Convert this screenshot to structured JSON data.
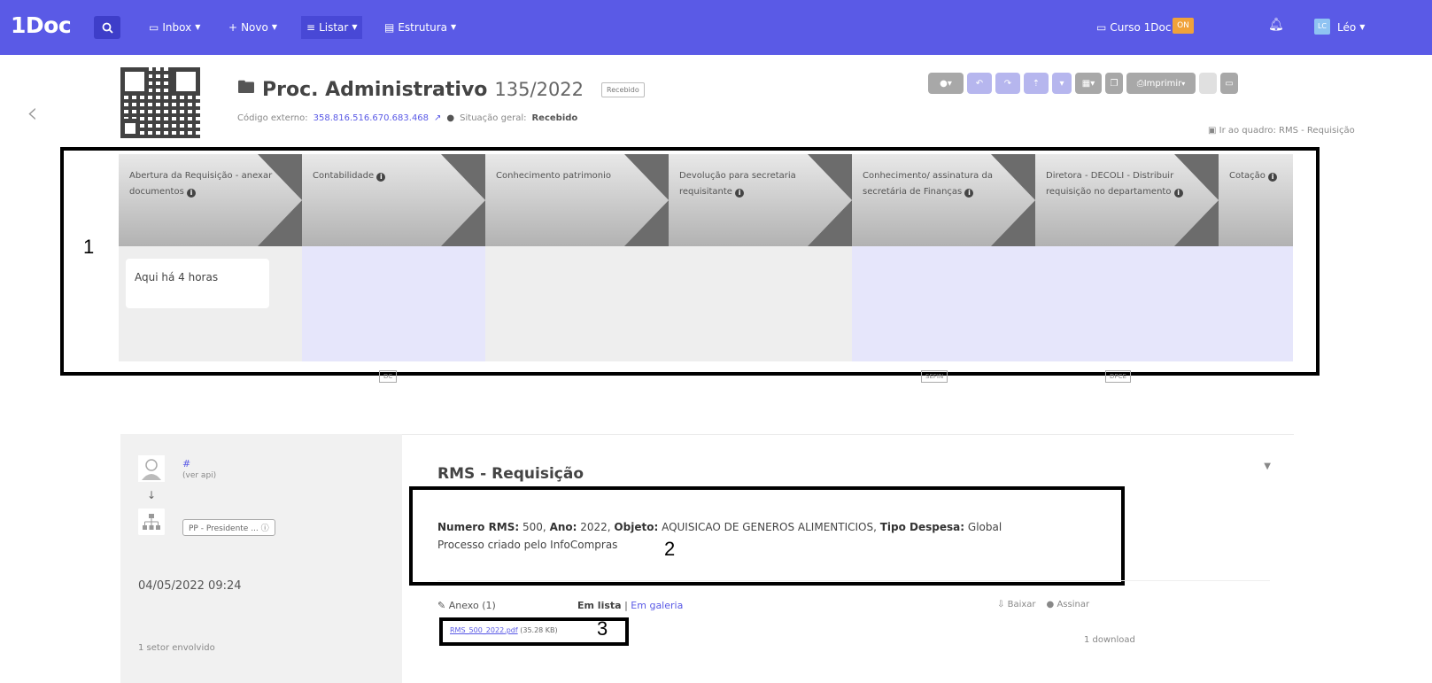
{
  "topbar": {
    "logo": "1Doc",
    "search_icon": "search-icon",
    "nav": [
      {
        "label": "Inbox",
        "icon": "inbox-icon"
      },
      {
        "label": "Novo",
        "icon": "plus-icon"
      },
      {
        "label": "Listar",
        "icon": "list-icon"
      },
      {
        "label": "Estrutura",
        "icon": "structure-icon"
      }
    ],
    "org_label": "Curso 1Doc",
    "org_badge": "ON",
    "user_label": "Léo",
    "color": "#5a5ae6"
  },
  "header": {
    "type": "Proc. Administrativo",
    "number": "135/2022",
    "status_pill": "Recebido",
    "external_code_label": "Código externo:",
    "external_code": "358.816.516.670.683.468",
    "situacao_label": "Situação geral:",
    "situacao_value": "Recebido",
    "print_label": "Imprimir",
    "goto_board": "Ir ao quadro: RMS - Requisição"
  },
  "workflow": {
    "annotation": "1",
    "stages": [
      {
        "label": "Abertura da Requisição - anexar documentos",
        "info": true,
        "card": "Aqui há 4 horas"
      },
      {
        "label": "Contabilidade",
        "info": true,
        "card": ""
      },
      {
        "label": "Conhecimento patrimonio",
        "info": false,
        "card": ""
      },
      {
        "label": "Devolução para secretaria requisitante",
        "info": true,
        "card": ""
      },
      {
        "label": "Conhecimento/ assinatura da secretária de Finanças",
        "info": true,
        "card": ""
      },
      {
        "label": "Diretora - DECOLI - Distribuir requisição no departamento",
        "info": true,
        "card": ""
      },
      {
        "label": "Cotação",
        "info": true,
        "card": ""
      }
    ],
    "tags": [
      "DC",
      "SEFIN",
      "DPCE"
    ]
  },
  "activity": {
    "hash": "#",
    "sub_note": "(ver api)",
    "org_pill": "PP - Presidente ...",
    "datetime": "04/05/2022 09:24",
    "sectors": "1 setor envolvido"
  },
  "document": {
    "title": "RMS - Requisição",
    "fields": [
      {
        "label": "Numero RMS:",
        "value": " 500, "
      },
      {
        "label": "Ano:",
        "value": " 2022, "
      },
      {
        "label": "Objeto:",
        "value": " AQUISICAO DE GENEROS ALIMENTICIOS, "
      },
      {
        "label": "Tipo Despesa:",
        "value": " Global"
      }
    ],
    "second_line": "Processo criado pelo InfoCompras",
    "annotation_2": "2",
    "attachments_label": "Anexo (1)",
    "view_list": "Em lista",
    "view_sep": "|",
    "view_gallery": "Em galeria",
    "download_label": "Baixar",
    "sign_label": "Assinar",
    "file_name": "RMS_500_2022.pdf",
    "file_size": "(35.28 KB)",
    "annotation_3": "3",
    "downloads": "1 download"
  }
}
